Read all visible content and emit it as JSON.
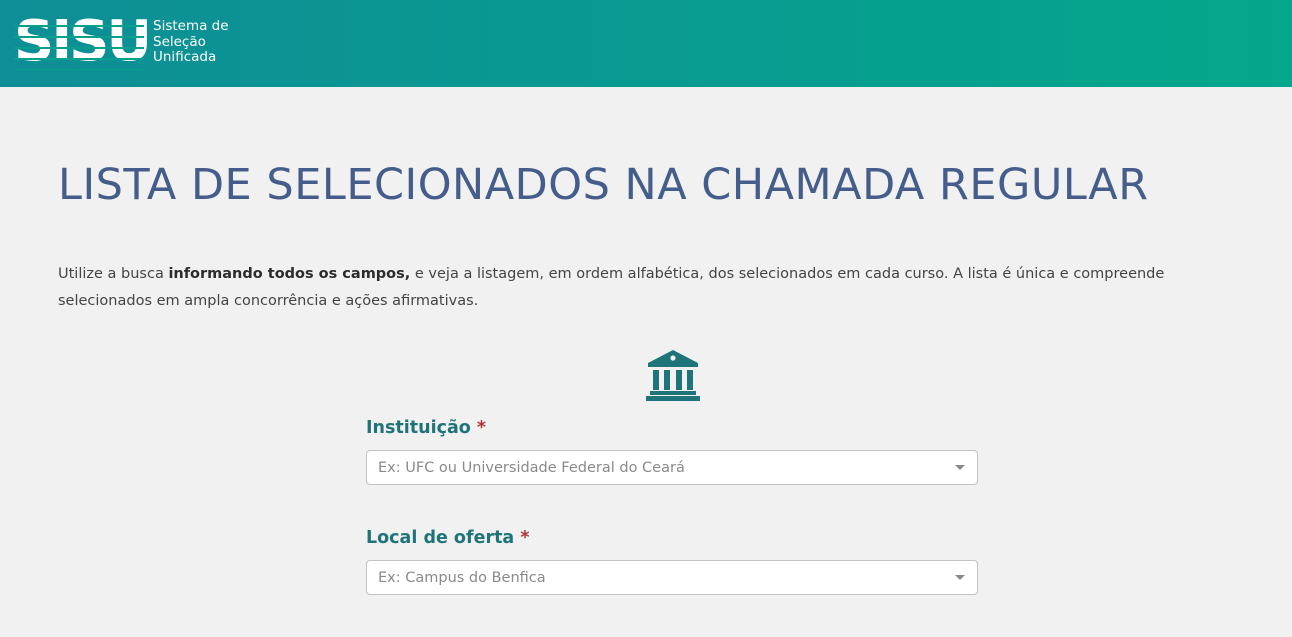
{
  "header": {
    "logo_mark": "SISU",
    "logo_lines": [
      "Sistema de",
      "Seleção",
      "Unificada"
    ]
  },
  "page": {
    "title": "LISTA DE SELECIONADOS NA CHAMADA REGULAR",
    "intro_before": "Utilize a busca ",
    "intro_bold": "informando todos os campos,",
    "intro_after": " e veja a listagem, em ordem alfabética, dos selecionados em cada curso. A lista é única e compreende selecionados em ampla concorrência e ações afirmativas."
  },
  "icons": {
    "institution": "institution-icon",
    "dropdown": "chevron-down-icon"
  },
  "form": {
    "instituicao": {
      "label": "Instituição",
      "required": "*",
      "placeholder": "Ex: UFC ou Universidade Federal do Ceará"
    },
    "local": {
      "label": "Local de oferta",
      "required": "*",
      "placeholder": "Ex: Campus do Benfica"
    }
  },
  "colors": {
    "header_start": "#0e8e96",
    "header_end": "#04a78b",
    "title": "#455d8a",
    "label": "#1f7479",
    "required": "#b03232"
  }
}
